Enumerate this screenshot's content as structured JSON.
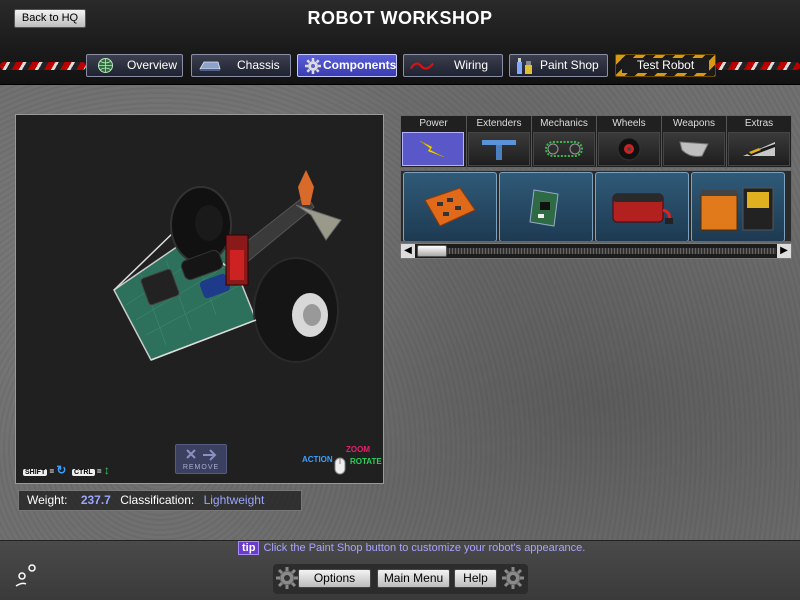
{
  "header": {
    "back_label": "Back to HQ",
    "title": "ROBOT WORKSHOP",
    "tabs": [
      {
        "label": "Overview",
        "icon": "globe-icon"
      },
      {
        "label": "Chassis",
        "icon": "chassis-icon"
      },
      {
        "label": "Components",
        "icon": "gear-icon",
        "active": true
      },
      {
        "label": "Wiring",
        "icon": "wire-icon"
      },
      {
        "label": "Paint Shop",
        "icon": "paint-icon"
      },
      {
        "label": "Test Robot",
        "icon": ""
      }
    ]
  },
  "viewport": {
    "remove_label": "REMOVE",
    "shift_key": "SHIFT",
    "ctrl_key": "CTRL",
    "equals": "=",
    "action_label": "ACTION",
    "zoom_label": "ZOOM",
    "rotate_label": "ROTATE"
  },
  "stats": {
    "weight_label": "Weight:",
    "weight_value": "237.7",
    "class_label": "Classification:",
    "class_value": "Lightweight"
  },
  "categories": [
    {
      "label": "Power",
      "icon": "lightning-icon",
      "active": true
    },
    {
      "label": "Extenders",
      "icon": "t-bar-icon"
    },
    {
      "label": "Mechanics",
      "icon": "chain-icon"
    },
    {
      "label": "Wheels",
      "icon": "wheel-icon"
    },
    {
      "label": "Weapons",
      "icon": "blade-icon"
    },
    {
      "label": "Extras",
      "icon": "ramp-icon"
    }
  ],
  "parts": [
    {
      "icon": "speed-controller-icon"
    },
    {
      "icon": "circuit-board-icon"
    },
    {
      "icon": "red-battery-icon"
    },
    {
      "icon": "battery-pack-icon"
    }
  ],
  "footer": {
    "tip_tag": "tip",
    "tip_text": "Click the Paint Shop button to customize your robot's appearance.",
    "options_label": "Options",
    "main_menu_label": "Main Menu",
    "help_label": "Help"
  },
  "colors": {
    "accent": "#5b60d8",
    "tip": "#a8a4ff",
    "value": "#9aa6ff"
  }
}
